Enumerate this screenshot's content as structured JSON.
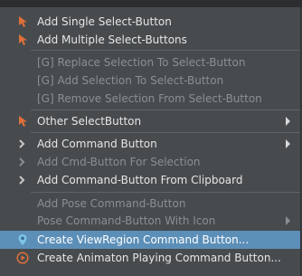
{
  "menu": {
    "items": [
      {
        "label": "Add Single Select-Button"
      },
      {
        "label": "Add Multiple Select-Buttons"
      },
      {
        "label": "[G] Replace Selection To Select-Button"
      },
      {
        "label": "[G] Add Selection To Select-Button"
      },
      {
        "label": "[G] Remove Selection From Select-Button"
      },
      {
        "label": "Other SelectButton"
      },
      {
        "label": "Add Command Button"
      },
      {
        "label": "Add Cmd-Button For Selection"
      },
      {
        "label": "Add Command-Button From Clipboard"
      },
      {
        "label": "Add Pose Command-Button"
      },
      {
        "label": "Pose Command-Button With Icon"
      },
      {
        "label": "Create ViewRegion Command Button..."
      },
      {
        "label": "Create Animaton Playing Command Button..."
      }
    ]
  },
  "colors": {
    "menu_bg": "#474b4e",
    "highlight": "#5c8fb8",
    "text": "#e6e6e6",
    "disabled_text": "#8b8f92",
    "icon_orange": "#e0703a",
    "icon_blue": "#7ec3e8"
  },
  "icons": [
    "cursor-select-icon",
    "chevron-command-icon",
    "location-pin-icon",
    "play-circle-icon"
  ]
}
